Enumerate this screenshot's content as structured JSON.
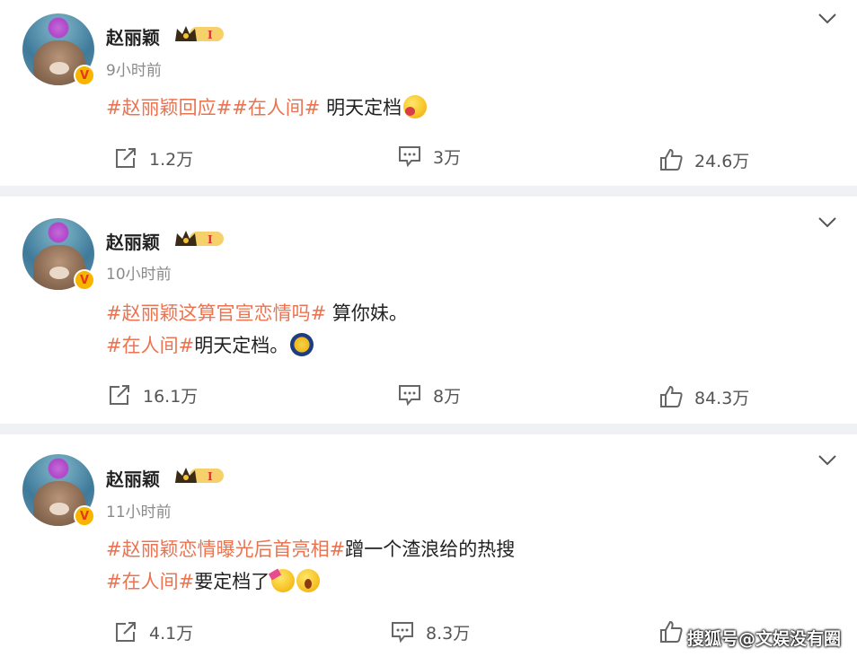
{
  "watermark": "搜狐号@文娱没有圈",
  "posts": [
    {
      "name": "赵丽颖",
      "level": "I",
      "time": "9小时前",
      "lines": [
        {
          "tags": "#赵丽颖回应##在人间#",
          "text": " 明天定档",
          "emoji": "tongue-face-emoji"
        }
      ],
      "repost": "1.2万",
      "comment": "3万",
      "like": "24.6万"
    },
    {
      "name": "赵丽颖",
      "level": "I",
      "time": "10小时前",
      "lines": [
        {
          "tags": "#赵丽颖这算官宣恋情吗#",
          "text": " 算你妹。"
        },
        {
          "tags": "#在人间#",
          "text": "明天定档。",
          "emoji": "moon-emoji"
        }
      ],
      "repost": "16.1万",
      "comment": "8万",
      "like": "84.3万"
    },
    {
      "name": "赵丽颖",
      "level": "I",
      "time": "11小时前",
      "lines": [
        {
          "tags": "#赵丽颖恋情曝光后首亮相#",
          "text": "蹭一个渣浪给的热搜"
        },
        {
          "tags": "#在人间#",
          "text": "要定档了",
          "emoji": "party-face-emoji",
          "emoji2": "shock-face-emoji"
        }
      ],
      "repost": "4.1万",
      "comment": "8.3万",
      "like": ""
    }
  ]
}
